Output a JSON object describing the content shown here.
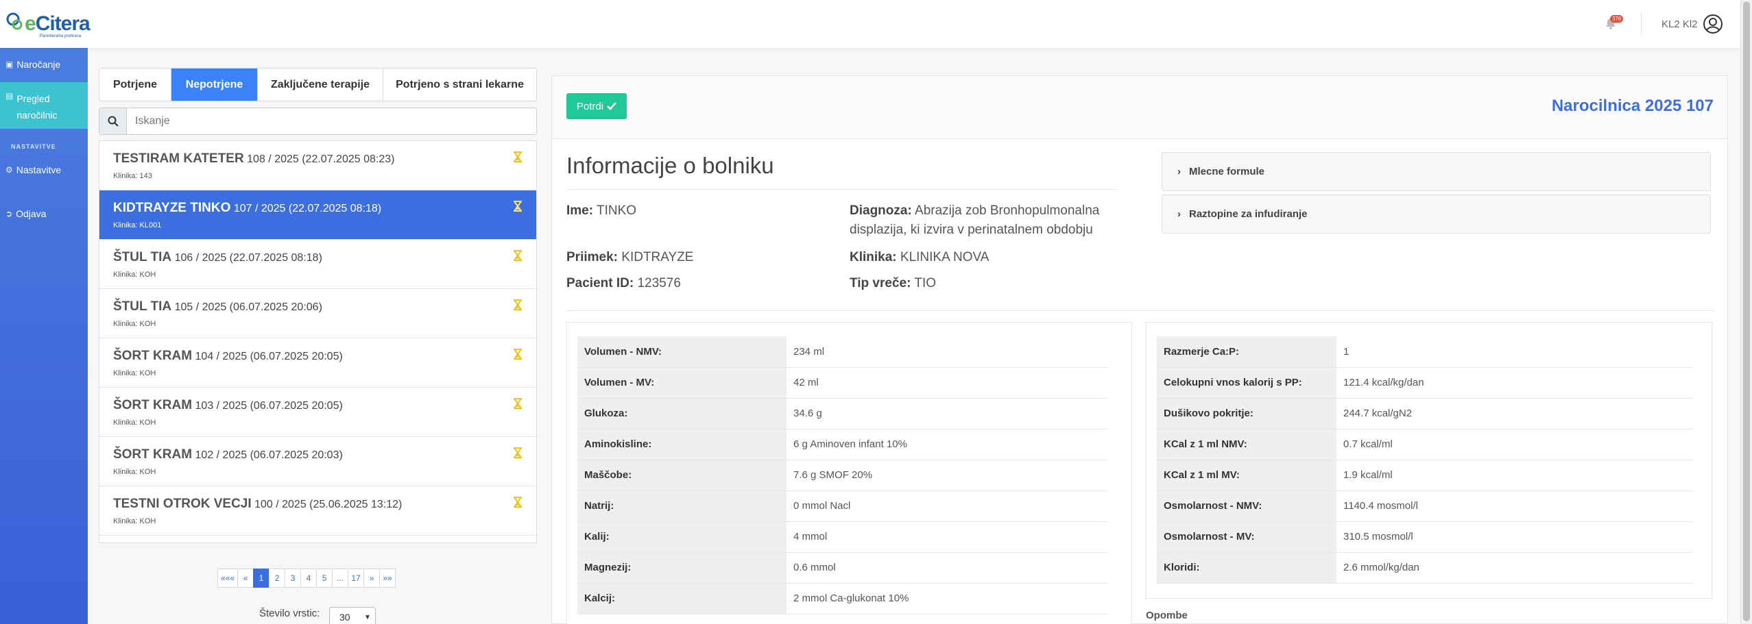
{
  "app": {
    "logo_text_prefix": "e",
    "logo_text": "Citera",
    "logo_subtitle": "Parenteralna prehrana",
    "notification_count": "376",
    "user_name": "KL2 Kl2"
  },
  "sidebar": {
    "items": [
      {
        "label": "Naročanje",
        "icon": "calendar-icon"
      },
      {
        "label": "Pregled naročilnic",
        "icon": "document-icon"
      },
      {
        "label": "Nastavitve",
        "icon": "gear-icon"
      },
      {
        "label": "Odjava",
        "icon": "logout-icon"
      }
    ],
    "section_heading": "NASTAVITVE"
  },
  "tabs": [
    {
      "label": "Potrjene",
      "active": false
    },
    {
      "label": "Nepotrjene",
      "active": true
    },
    {
      "label": "Zaključene terapije",
      "active": false
    },
    {
      "label": "Potrjeno s strani lekarne",
      "active": false
    }
  ],
  "search": {
    "placeholder": "Iskanje"
  },
  "orders": [
    {
      "name": "TESTIRAM KATETER",
      "meta": "108 / 2025 (22.07.2025 08:23)",
      "clinic": "Klinika: 143",
      "selected": false
    },
    {
      "name": "KIDTRAYZE TINKO",
      "meta": "107 / 2025 (22.07.2025 08:18)",
      "clinic": "Klinika: KL001",
      "selected": true
    },
    {
      "name": "ŠTUL TIA",
      "meta": "106 / 2025 (22.07.2025 08:18)",
      "clinic": "Klinika: KOH",
      "selected": false
    },
    {
      "name": "ŠTUL TIA",
      "meta": "105 / 2025 (06.07.2025 20:06)",
      "clinic": "Klinika: KOH",
      "selected": false
    },
    {
      "name": "ŠORT KRAM",
      "meta": "104 / 2025 (06.07.2025 20:05)",
      "clinic": "Klinika: KOH",
      "selected": false
    },
    {
      "name": "ŠORT KRAM",
      "meta": "103 / 2025 (06.07.2025 20:05)",
      "clinic": "Klinika: KOH",
      "selected": false
    },
    {
      "name": "ŠORT KRAM",
      "meta": "102 / 2025 (06.07.2025 20:03)",
      "clinic": "Klinika: KOH",
      "selected": false
    },
    {
      "name": "TESTNI OTROK VECJI",
      "meta": "100 / 2025 (25.06.2025 13:12)",
      "clinic": "Klinika: KOH",
      "selected": false
    }
  ],
  "pagination": {
    "pages": [
      "«««",
      "«",
      "1",
      "2",
      "3",
      "4",
      "5",
      "...",
      "17",
      "»",
      "»»"
    ],
    "active": "1",
    "rows_label": "Število vrstic:",
    "rows_value": "30"
  },
  "detail": {
    "confirm_label": "Potrdi",
    "order_title": "Narocilnica 2025 107",
    "info_heading": "Informacije o bolniku",
    "fields": {
      "ime_label": "Ime:",
      "ime": "TINKO",
      "priimek_label": "Priimek:",
      "priimek": "KIDTRAYZE",
      "pacient_label": "Pacient ID:",
      "pacient": "123576",
      "diagnoza_label": "Diagnoza:",
      "diagnoza": "Abrazija zob Bronhopulmonalna displazija, ki izvira v perinatalnem obdobju",
      "klinika_label": "Klinika:",
      "klinika": "KLINIKA NOVA",
      "tip_label": "Tip vreče:",
      "tip": "TIO"
    },
    "accordions": [
      "Mlecne formule",
      "Raztopine za infudiranje"
    ],
    "table_left": [
      {
        "k": "Volumen - NMV:",
        "v": "234 ml"
      },
      {
        "k": "Volumen - MV:",
        "v": "42 ml"
      },
      {
        "k": "Glukoza:",
        "v": "34.6 g"
      },
      {
        "k": "Aminokisline:",
        "v": "6 g Aminoven infant 10%"
      },
      {
        "k": "Maščobe:",
        "v": "7.6 g SMOF 20%"
      },
      {
        "k": "Natrij:",
        "v": "0 mmol Nacl"
      },
      {
        "k": "Kalij:",
        "v": "4 mmol"
      },
      {
        "k": "Magnezij:",
        "v": "0.6 mmol"
      },
      {
        "k": "Kalcij:",
        "v": "2 mmol Ca-glukonat 10%"
      }
    ],
    "table_right": [
      {
        "k": "Razmerje Ca:P:",
        "v": "1"
      },
      {
        "k": "Celokupni vnos kalorij s PP:",
        "v": "121.4 kcal/kg/dan"
      },
      {
        "k": "Dušikovo pokritje:",
        "v": "244.7 kcal/gN2"
      },
      {
        "k": "KCal z 1 ml NMV:",
        "v": "0.7 kcal/ml"
      },
      {
        "k": "KCal z 1 ml MV:",
        "v": "1.9 kcal/ml"
      },
      {
        "k": "Osmolarnost - NMV:",
        "v": "1140.4 mosmol/l"
      },
      {
        "k": "Osmolarnost - MV:",
        "v": "310.5 mosmol/l"
      },
      {
        "k": "Kloridi:",
        "v": "2.6 mmol/kg/dan"
      }
    ],
    "opombe_label": "Opombe"
  },
  "colors": {
    "primary": "#3b82f6",
    "sidebar": "#3a5fd6",
    "sidebar_active": "#3bc3d0",
    "confirm": "#20c997",
    "hourglass": "#f0c419"
  }
}
